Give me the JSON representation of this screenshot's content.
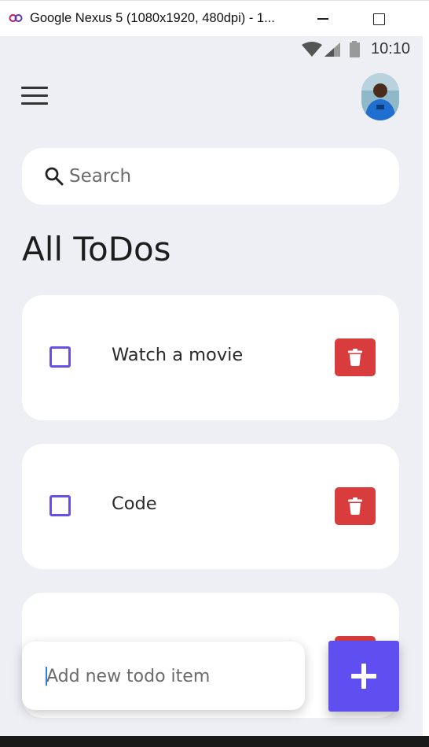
{
  "window": {
    "title": "Google Nexus 5 (1080x1920, 480dpi) - 1..."
  },
  "status_bar": {
    "time": "10:10",
    "icons": [
      "wifi-icon",
      "cell-signal-icon",
      "battery-icon"
    ]
  },
  "header": {
    "menu_icon": "hamburger-menu-icon",
    "avatar": "user-avatar"
  },
  "search": {
    "placeholder": "Search",
    "value": ""
  },
  "page": {
    "title": "All ToDos"
  },
  "todos": [
    {
      "label": "Watch a movie",
      "done": false
    },
    {
      "label": "Code",
      "done": false
    },
    {
      "label": "",
      "done": false
    }
  ],
  "new_todo": {
    "placeholder": "Add new todo item",
    "value": ""
  },
  "colors": {
    "background": "#eeeff5",
    "checkbox": "#6a4ee8",
    "delete": "#d93c3c",
    "add_button": "#5f4ff0"
  }
}
